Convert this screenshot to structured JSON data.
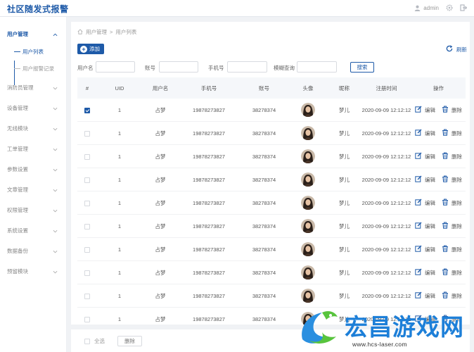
{
  "app": {
    "title": "社区随发式报警"
  },
  "header": {
    "username": "admin",
    "user_icon": "user-icon",
    "settings_icon": "gear-icon",
    "logout_icon": "logout-icon"
  },
  "sidebar": {
    "items": [
      {
        "label": "用户管理",
        "expanded": true,
        "children": [
          {
            "label": "用户列表",
            "current": true
          },
          {
            "label": "用户报警记录",
            "current": false
          }
        ]
      },
      {
        "label": "消防员管理"
      },
      {
        "label": "设备管理"
      },
      {
        "label": "无线模块"
      },
      {
        "label": "工单管理"
      },
      {
        "label": "参数设置"
      },
      {
        "label": "文章管理"
      },
      {
        "label": "权限管理"
      },
      {
        "label": "系统设置"
      },
      {
        "label": "数据备份"
      },
      {
        "label": "预留模块"
      }
    ]
  },
  "breadcrumb": {
    "home_icon": "home-icon",
    "section": "用户管理",
    "separator": ">",
    "page": "用户列表"
  },
  "toolbar": {
    "add_label": "添加",
    "refresh_label": "刷新"
  },
  "filters": {
    "username_label": "用户名",
    "account_label": "账号",
    "phone_label": "手机号",
    "fuzzy_label": "模糊查询",
    "search_label": "搜索"
  },
  "table": {
    "columns": [
      "#",
      "UID",
      "用户名",
      "手机号",
      "账号",
      "头像",
      "昵称",
      "注册时间",
      "操作"
    ],
    "edit_label": "编辑",
    "delete_label": "删除",
    "rows": [
      {
        "checked": true,
        "uid": "1",
        "username": "占梦",
        "phone": "19878273827",
        "account": "38278374",
        "nickname": "梦儿",
        "registered": "2020-09-09 12:12:12"
      },
      {
        "checked": false,
        "uid": "1",
        "username": "占梦",
        "phone": "19878273827",
        "account": "38278374",
        "nickname": "梦儿",
        "registered": "2020-09-09 12:12:12"
      },
      {
        "checked": false,
        "uid": "1",
        "username": "占梦",
        "phone": "19878273827",
        "account": "38278374",
        "nickname": "梦儿",
        "registered": "2020-09-09 12:12:12"
      },
      {
        "checked": false,
        "uid": "1",
        "username": "占梦",
        "phone": "19878273827",
        "account": "38278374",
        "nickname": "梦儿",
        "registered": "2020-09-09 12:12:12"
      },
      {
        "checked": false,
        "uid": "1",
        "username": "占梦",
        "phone": "19878273827",
        "account": "38278374",
        "nickname": "梦儿",
        "registered": "2020-09-09 12:12:12"
      },
      {
        "checked": false,
        "uid": "1",
        "username": "占梦",
        "phone": "19878273827",
        "account": "38278374",
        "nickname": "梦儿",
        "registered": "2020-09-09 12:12:12"
      },
      {
        "checked": false,
        "uid": "1",
        "username": "占梦",
        "phone": "19878273827",
        "account": "38278374",
        "nickname": "梦儿",
        "registered": "2020-09-09 12:12:12"
      },
      {
        "checked": false,
        "uid": "1",
        "username": "占梦",
        "phone": "19878273827",
        "account": "38278374",
        "nickname": "梦儿",
        "registered": "2020-09-09 12:12:12"
      },
      {
        "checked": false,
        "uid": "1",
        "username": "占梦",
        "phone": "19878273827",
        "account": "38278374",
        "nickname": "梦儿",
        "registered": "2020-09-09 12:12:12"
      },
      {
        "checked": false,
        "uid": "1",
        "username": "占梦",
        "phone": "19878273827",
        "account": "38278374",
        "nickname": "梦儿",
        "registered": "2020-09-09 12:12:12"
      }
    ]
  },
  "footer": {
    "select_all_label": "全选",
    "bulk_delete_label": "删除"
  },
  "watermark": {
    "text": "宏昌游戏网",
    "url": "www.hcs-laser.com"
  },
  "colors": {
    "primary": "#1e5aa8",
    "watermark": "#1d7fd8"
  }
}
